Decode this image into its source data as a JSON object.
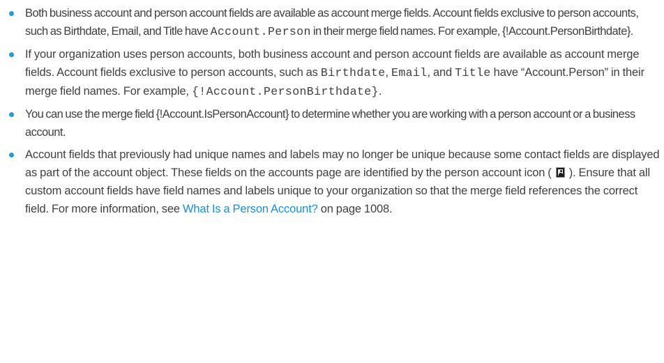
{
  "colors": {
    "bullet": "#1f9be0",
    "link": "#1a8fdb",
    "text": "#404040"
  },
  "bullets": [
    {
      "part1": "Both business account and person account fields are available as account merge fields. Account fields exclusive to person accounts, such as Birthdate, Email, and Title have ",
      "code1": "Account.Person",
      "part2": " in their merge field names. For example, {!Account.PersonBirthdate}."
    },
    {
      "part1": "If your organization uses person accounts, both business account and person account fields are available as account merge fields. Account fields exclusive to person accounts, such as ",
      "code1": "Birthdate",
      "sep1": ", ",
      "code2": "Email",
      "sep2": ", and ",
      "code3": "Title",
      "part2": " have “Account.Person” in their merge field names. For example, ",
      "code4": "{!Account.PersonBirthdate}",
      "part3": "."
    },
    {
      "text": "You can use the merge field {!Account.IsPersonAccount} to determine whether you are working with a person account or a business account."
    },
    {
      "part1": "Account fields that previously had unique names and labels may no longer be unique because some contact fields are displayed as part of the account object. These fields on the accounts page are identified by the person account icon ( ",
      "icon": "person-account-icon",
      "part2": " ). Ensure that all custom account fields have field names and labels unique to your organization so that the merge field references the correct field. For more information, see ",
      "link_text": "What Is a Person Account?",
      "part3": " on page 1008."
    }
  ]
}
